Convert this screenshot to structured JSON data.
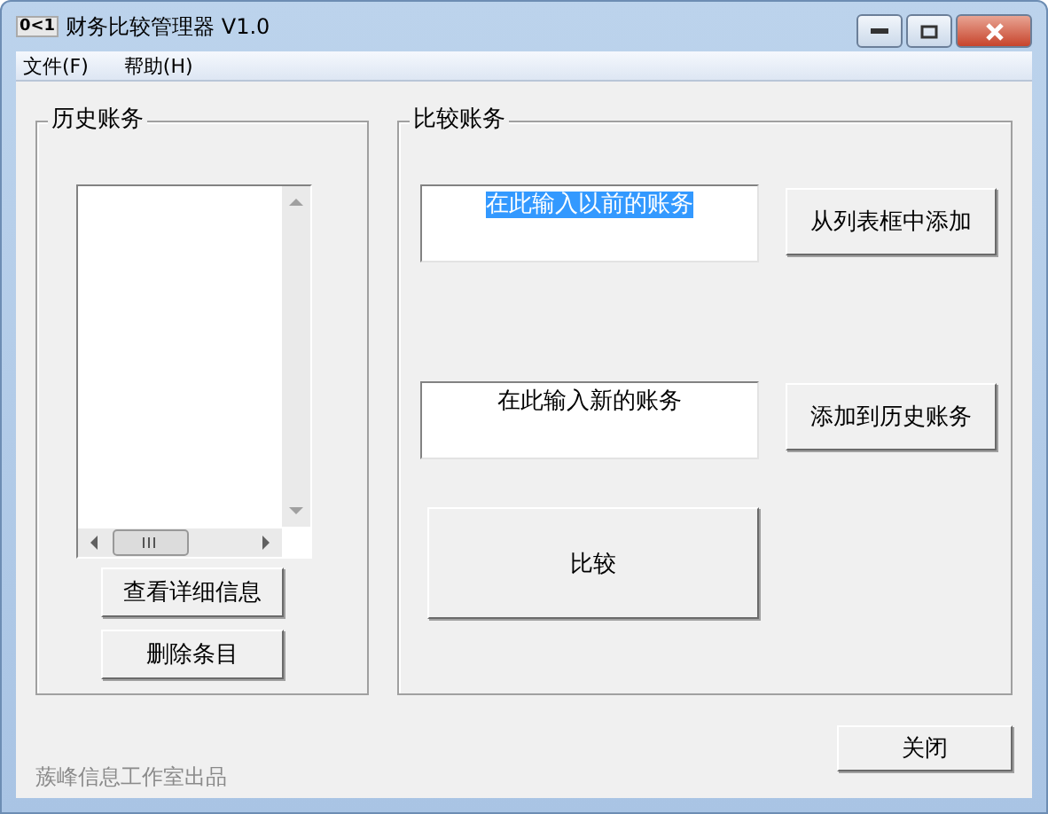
{
  "window": {
    "icon_text": "0<1",
    "title": "财务比较管理器 V1.0"
  },
  "menu": [
    {
      "label": "文件(F)"
    },
    {
      "label": "帮助(H)"
    }
  ],
  "history_group": {
    "title": "历史账务",
    "buttons": [
      "查看详细信息",
      "删除条目"
    ]
  },
  "compare_group": {
    "title": "比较账务",
    "rows": [
      {
        "value": "在此输入以前的账务",
        "text_selected": true,
        "button": "从列表框中添加"
      },
      {
        "value": "在此输入新的账务",
        "text_selected": false,
        "button": "添加到历史账务"
      }
    ],
    "compare_button": "比较"
  },
  "footer": {
    "credit": "蔟峰信息工作室出品",
    "close_button": "关闭"
  }
}
